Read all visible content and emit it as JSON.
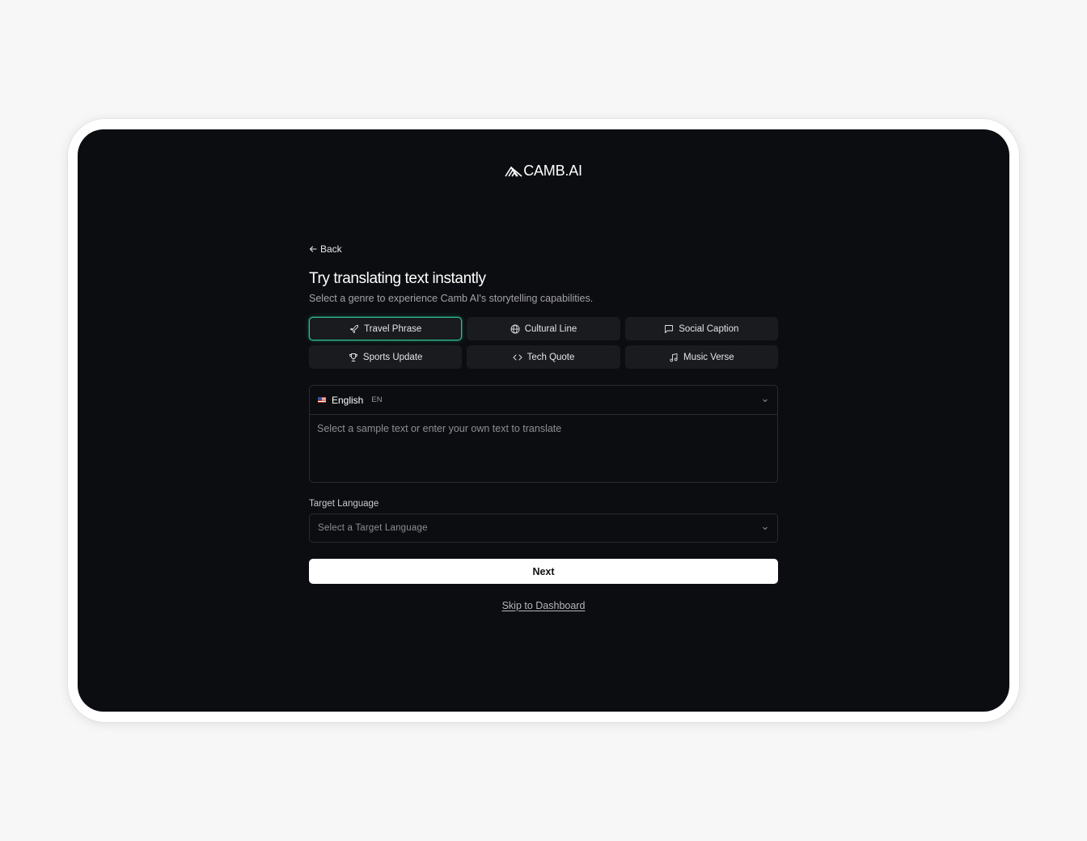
{
  "brand": {
    "name": "CAMB.AI"
  },
  "nav": {
    "back_label": "Back"
  },
  "heading": {
    "title": "Try translating text instantly",
    "subtitle": "Select a genre to experience Camb AI's storytelling capabilities."
  },
  "genres": [
    {
      "label": "Travel Phrase",
      "icon": "plane-icon",
      "selected": true
    },
    {
      "label": "Cultural Line",
      "icon": "globe-icon",
      "selected": false
    },
    {
      "label": "Social Caption",
      "icon": "message-icon",
      "selected": false
    },
    {
      "label": "Sports Update",
      "icon": "trophy-icon",
      "selected": false
    },
    {
      "label": "Tech Quote",
      "icon": "code-icon",
      "selected": false
    },
    {
      "label": "Music Verse",
      "icon": "music-icon",
      "selected": false
    }
  ],
  "source": {
    "language": "English",
    "language_code": "EN",
    "flag": "us-flag-icon",
    "placeholder": "Select a sample text or enter your own text to translate"
  },
  "target": {
    "label": "Target Language",
    "placeholder": "Select a Target Language"
  },
  "actions": {
    "next_label": "Next",
    "skip_label": "Skip to Dashboard"
  },
  "colors": {
    "page_bg": "#f7f7f7",
    "screen_bg": "#0c0d10",
    "card_bg": "#1a1b1f",
    "selected_accent": "#2fbf8f",
    "primary_button_bg": "#ffffff"
  }
}
